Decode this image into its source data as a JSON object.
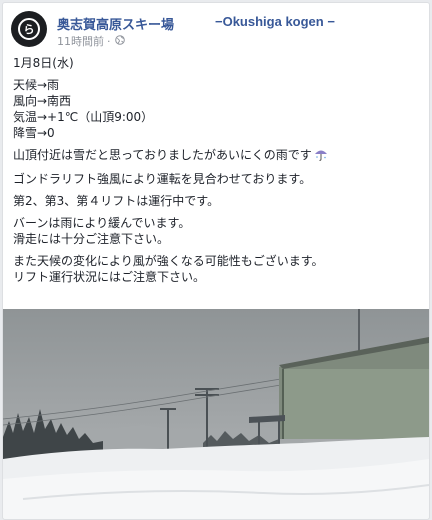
{
  "post": {
    "page_name": "奥志賀高原スキー場",
    "page_tag": "−Okushiga kogen −",
    "timestamp": "11時間前",
    "separator": "·",
    "privacy_icon": "globe-icon",
    "avatar_icon": "page-logo-icon",
    "avatar_letter": "ら",
    "date": "1月8日(水)",
    "weather_lines": [
      "天候→雨",
      "風向→南西",
      "気温→+1℃（山頂9:00）",
      "降雪→0"
    ],
    "paragraph_1": "山頂付近は雪だと思っておりましたがあいにくの雨です",
    "umbrella_icon": "umbrella-icon",
    "paragraph_2": "ゴンドラリフト強風により運転を見合わせております。",
    "paragraph_3": "第2、第3、第４リフトは運行中です。",
    "paragraph_4_lines": [
      "バーンは雨により緩んでいます。",
      "滑走には十分ご注意下さい。"
    ],
    "paragraph_5_lines": [
      "また天候の変化により風が強くなる可能性もございます。",
      "リフト運行状況にはご注意下さい。"
    ]
  },
  "colors": {
    "link": "#385898",
    "text": "#1d2129",
    "meta": "#90949c",
    "sky": "#9ea2a4",
    "snow": "#eef0f2"
  }
}
